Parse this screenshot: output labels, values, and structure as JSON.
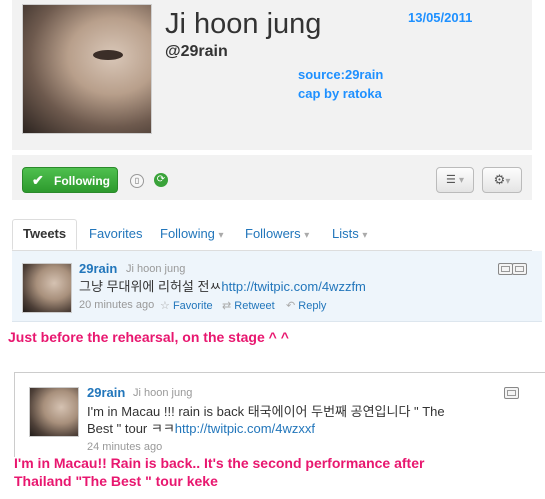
{
  "profile": {
    "name": "Ji hoon jung",
    "handle": "@29rain",
    "date": "13/05/2011",
    "source": "source:29rain",
    "cap": "cap by ratoka"
  },
  "actions": {
    "following_label": "Following"
  },
  "tabs": [
    {
      "label": "Tweets"
    },
    {
      "label": "Favorites"
    },
    {
      "label": "Following"
    },
    {
      "label": "Followers"
    },
    {
      "label": "Lists"
    }
  ],
  "tweets": [
    {
      "user": "29rain",
      "fullname": "Ji hoon jung",
      "text": "그냥 무대위에 리허설 전ㅆ",
      "link": "http://twitpic.com/4wzzfm",
      "time": "20 minutes ago",
      "favorite_label": "Favorite",
      "retweet_label": "Retweet",
      "reply_label": "Reply"
    },
    {
      "user": "29rain",
      "fullname": "Ji hoon jung",
      "text_line1": "I'm in Macau !!! rain is back 태국에이어 두번째 공연입니다 \" The",
      "text_line2": "Best \" tour ㅋㅋ",
      "link": "http://twitpic.com/4wzxxf",
      "time": "24 minutes ago"
    }
  ],
  "captions": {
    "caption1": "Just before the rehearsal, on the stage ^ ^",
    "caption2_line1": "I'm in Macau!! Rain is back.. It's the second performance after",
    "caption2_line2": "Thailand \"The Best \" tour keke"
  },
  "colors": {
    "accent": "#1e90ff",
    "caption": "#e8176f",
    "follow_green": "#3aa33a",
    "link": "#2276bb"
  }
}
